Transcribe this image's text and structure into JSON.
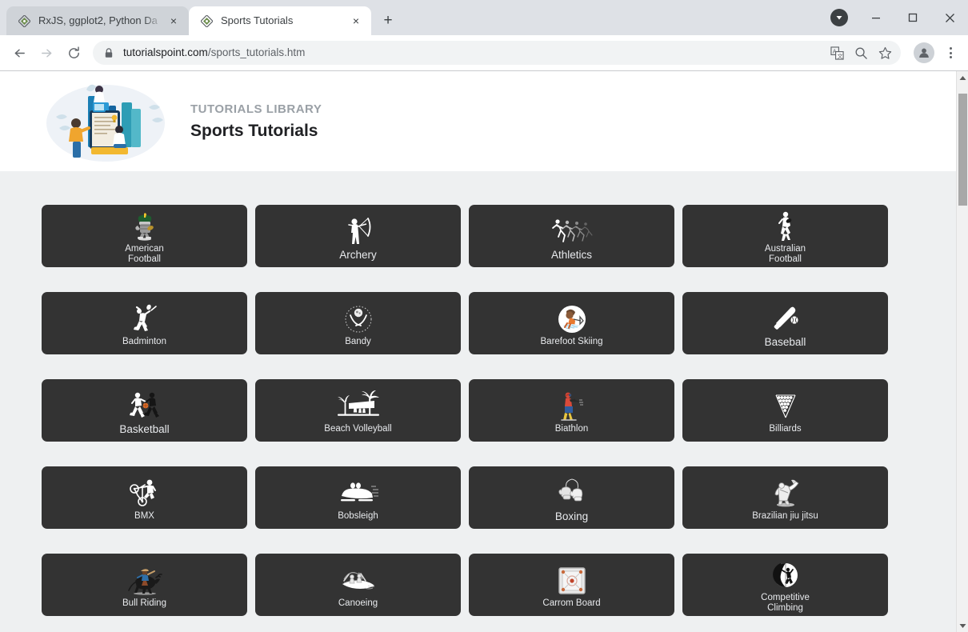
{
  "window": {
    "controls": {
      "downloads": "downloads-indicator",
      "minimize": "Minimize",
      "maximize": "Maximize",
      "close": "Close"
    }
  },
  "tabs": [
    {
      "title": "RxJS, ggplot2, Python Da",
      "favicon": "tutorialspoint-favicon",
      "active": false,
      "close": "×"
    },
    {
      "title": "Sports Tutorials",
      "favicon": "tutorialspoint-favicon",
      "active": true,
      "close": "×"
    }
  ],
  "newtab_label": "+",
  "toolbar": {
    "back": "back-arrow",
    "forward": "forward-arrow",
    "reload": "reload",
    "url_host": "tutorialspoint.com",
    "url_path": "/sports_tutorials.htm",
    "url_full": "tutorialspoint.com/sports_tutorials.htm",
    "translate": "translate-icon",
    "zoom": "zoom-search-icon",
    "bookmark": "star-icon",
    "profile": "profile-avatar",
    "menu": "three-dot-menu"
  },
  "page": {
    "header": {
      "kicker": "TUTORIALS LIBRARY",
      "title": "Sports Tutorials"
    },
    "tiles": [
      {
        "label": "American\nFootball",
        "icon": "american-football-icon",
        "size": "sm"
      },
      {
        "label": "Archery",
        "icon": "archery-icon",
        "size": "lg"
      },
      {
        "label": "Athletics",
        "icon": "athletics-icon",
        "size": "lg"
      },
      {
        "label": "Australian\nFootball",
        "icon": "australian-football-icon",
        "size": "sm"
      },
      {
        "label": "Badminton",
        "icon": "badminton-icon",
        "size": "sm"
      },
      {
        "label": "Bandy",
        "icon": "bandy-icon",
        "size": "sm"
      },
      {
        "label": "Barefoot Skiing",
        "icon": "barefoot-skiing-icon",
        "size": "sm"
      },
      {
        "label": "Baseball",
        "icon": "baseball-icon",
        "size": "lg"
      },
      {
        "label": "Basketball",
        "icon": "basketball-icon",
        "size": "lg"
      },
      {
        "label": "Beach Volleyball",
        "icon": "beach-volleyball-icon",
        "size": "sm"
      },
      {
        "label": "Biathlon",
        "icon": "biathlon-icon",
        "size": "sm"
      },
      {
        "label": "Billiards",
        "icon": "billiards-icon",
        "size": "sm"
      },
      {
        "label": "BMX",
        "icon": "bmx-icon",
        "size": "sm"
      },
      {
        "label": "Bobsleigh",
        "icon": "bobsleigh-icon",
        "size": "sm"
      },
      {
        "label": "Boxing",
        "icon": "boxing-icon",
        "size": "lg"
      },
      {
        "label": "Brazilian jiu jitsu",
        "icon": "brazilian-jiu-jitsu-icon",
        "size": "sm"
      },
      {
        "label": "Bull Riding",
        "icon": "bull-riding-icon",
        "size": "sm"
      },
      {
        "label": "Canoeing",
        "icon": "canoeing-icon",
        "size": "sm"
      },
      {
        "label": "Carrom Board",
        "icon": "carrom-board-icon",
        "size": "sm"
      },
      {
        "label": "Competitive\nClimbing",
        "icon": "competitive-climbing-icon",
        "size": "sm"
      }
    ]
  },
  "colors": {
    "tile_bg": "#333333",
    "page_bg": "#eef0f1",
    "tab_active": "#ffffff",
    "tab_inactive": "#cfd3d8",
    "chrome_bg": "#dee1e6",
    "kicker": "#9aa0a6"
  }
}
